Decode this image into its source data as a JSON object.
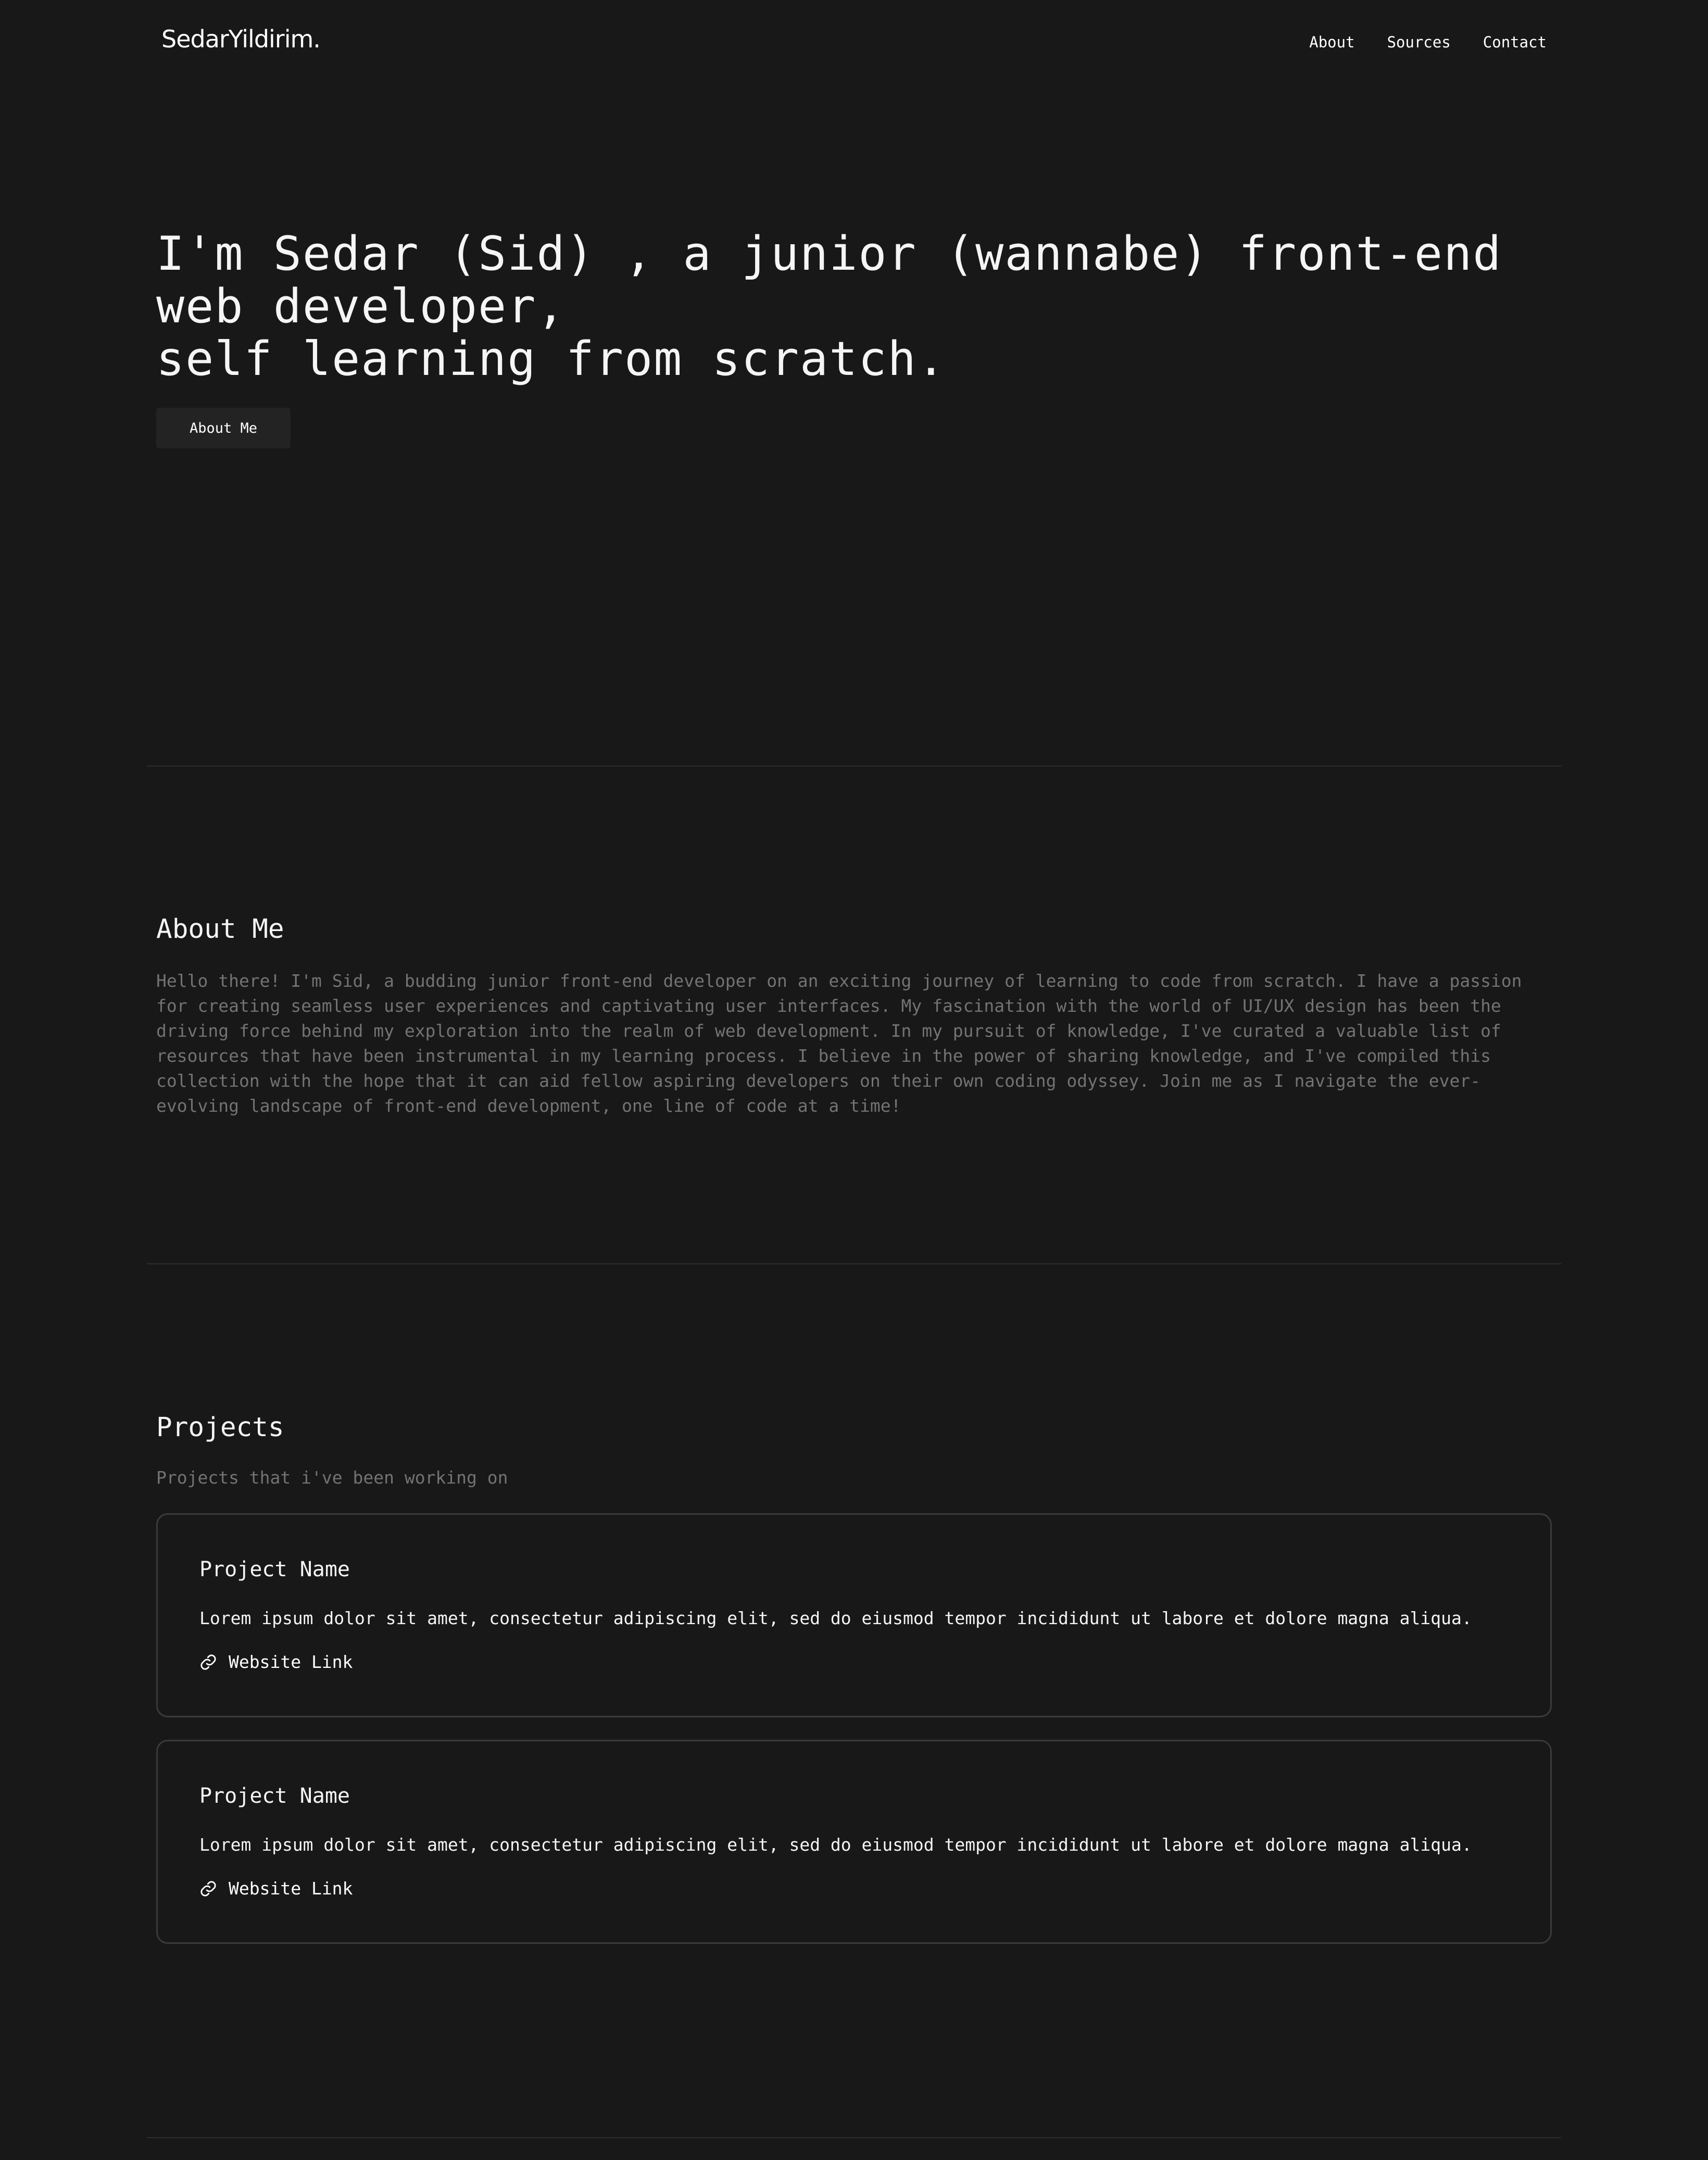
{
  "header": {
    "brand": "SedarYildirim.",
    "nav": [
      "About",
      "Sources",
      "Contact"
    ]
  },
  "hero": {
    "title_line1": "I'm Sedar (Sid) , a junior (wannabe) front-end web developer,",
    "title_line2": "self learning from scratch.",
    "button_label": "About Me"
  },
  "about": {
    "title": "About Me",
    "text": "Hello there! I'm Sid, a budding junior front-end developer on an exciting journey of learning to code from scratch. I have a passion for creating seamless user experiences and captivating user interfaces. My fascination with the world of UI/UX design has been the driving force behind my exploration into the realm of web development. In my pursuit of knowledge, I've curated a valuable list of resources that have been instrumental in my learning process. I believe in the power of sharing knowledge, and I've compiled this collection with the hope that it can aid fellow aspiring developers on their own coding odyssey. Join me as I navigate the ever-evolving landscape of front-end development, one line of code at a time!"
  },
  "projects": {
    "title": "Projects",
    "subtitle": "Projects that i've been working on",
    "items": [
      {
        "name": "Project Name",
        "description": "Lorem ipsum dolor sit amet, consectetur adipiscing elit, sed do eiusmod tempor incididunt ut labore et dolore magna aliqua.",
        "link_label": "Website Link",
        "link_icon": "link-icon"
      },
      {
        "name": "Project Name",
        "description": "Lorem ipsum dolor sit amet, consectetur adipiscing elit, sed do eiusmod tempor incididunt ut labore et dolore magna aliqua.",
        "link_label": "Website Link",
        "link_icon": "link-icon"
      }
    ]
  },
  "colors": {
    "background": "#181818",
    "text": "#f5f5f5",
    "muted_text": "#737373",
    "card_border": "#3a3a3a",
    "divider": "#2d2d2d",
    "button_bg": "#232323"
  }
}
